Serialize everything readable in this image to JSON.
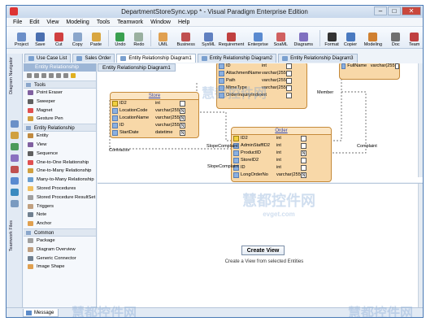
{
  "window": {
    "title": "DepartmentStoreSync.vpp * - Visual Paradigm Enterprise Edition",
    "controls": {
      "minimize": "–",
      "maximize": "□",
      "close": "✕"
    }
  },
  "menu": [
    "File",
    "Edit",
    "View",
    "Modeling",
    "Tools",
    "Teamwork",
    "Window",
    "Help"
  ],
  "toolbar": [
    {
      "label": "Project",
      "icon": "project-icon",
      "color": "#6b8ec8"
    },
    {
      "label": "Save",
      "icon": "save-icon",
      "color": "#4a6fb0"
    },
    {
      "label": "Cut",
      "icon": "cut-icon",
      "color": "#d04040"
    },
    {
      "label": "Copy",
      "icon": "copy-icon",
      "color": "#8aa6cb"
    },
    {
      "label": "Paste",
      "icon": "paste-icon",
      "color": "#d9a640"
    },
    {
      "label": "Undo",
      "icon": "undo-icon",
      "color": "#3aa050"
    },
    {
      "label": "Redo",
      "icon": "redo-icon",
      "color": "#9ab0a0"
    },
    {
      "label": "UML",
      "icon": "uml-icon",
      "color": "#e0a050"
    },
    {
      "label": "Business",
      "icon": "business-icon",
      "color": "#c05050"
    },
    {
      "label": "SysML",
      "icon": "sysml-icon",
      "color": "#6080c0"
    },
    {
      "label": "Requirement",
      "icon": "requirement-icon",
      "color": "#c04040"
    },
    {
      "label": "Enterprise",
      "icon": "enterprise-icon",
      "color": "#5a8ad0"
    },
    {
      "label": "SoaML",
      "icon": "soaml-icon",
      "color": "#d06060"
    },
    {
      "label": "Diagrams",
      "icon": "diagrams-icon",
      "color": "#8070c0"
    },
    {
      "label": "Format",
      "icon": "format-icon",
      "color": "#333333"
    },
    {
      "label": "Copier",
      "icon": "copier-icon",
      "color": "#4a7ac0"
    },
    {
      "label": "Modeling",
      "icon": "modeling-icon",
      "color": "#d08030"
    },
    {
      "label": "Doc",
      "icon": "doc-icon",
      "color": "#707070"
    },
    {
      "label": "Team",
      "icon": "team-icon",
      "color": "#c04040"
    }
  ],
  "tabs": [
    "Use Case List",
    "Sales Order",
    "Entity Relationship Diagram1",
    "Entity Relationship Diagram2",
    "Entity Relationship Diagram3"
  ],
  "active_tab": 2,
  "left_strip": {
    "top_label": "Diagram Navigator",
    "bottom_label": "Teamwork Files"
  },
  "palette": {
    "title": "Entity Relationship Diagram1",
    "sections": {
      "tools": "Tools",
      "tools_items": [
        "Point Eraser",
        "Sweeper",
        "Magnet",
        "Gesture Pen"
      ],
      "er": "Entity Relationship",
      "er_items": [
        "Entity",
        "View",
        "Sequence",
        "One-to-One Relationship",
        "One-to-Many Relationship",
        "Many-to-Many Relationship",
        "Stored Procedures",
        "Stored Procedure ResultSet",
        "Triggers",
        "Note",
        "Anchor"
      ],
      "common": "Common",
      "common_items": [
        "Package",
        "Diagram Overview",
        "Generic Connector",
        "Image Shape"
      ]
    }
  },
  "canvas": {
    "diagram_label": "Entity Relationship Diagram1",
    "entities": {
      "store": {
        "name": "Store",
        "rows": [
          {
            "key": "pk",
            "name": "ID2",
            "type": "int",
            "nn": ""
          },
          {
            "key": "col",
            "name": "LocationCode",
            "type": "varchar(255)",
            "nn": "N"
          },
          {
            "key": "col",
            "name": "LocationName",
            "type": "varchar(255)",
            "nn": "N"
          },
          {
            "key": "col",
            "name": "ID",
            "type": "varchar(255)",
            "nn": "N"
          },
          {
            "key": "col",
            "name": "StartDate",
            "type": "datetime",
            "nn": "N"
          }
        ]
      },
      "attachment": {
        "name": "",
        "rows": [
          {
            "key": "col",
            "name": "ID",
            "type": "int",
            "nn": ""
          },
          {
            "key": "col",
            "name": "AttachmentName",
            "type": "varchar(255)",
            "nn": ""
          },
          {
            "key": "col",
            "name": "Path",
            "type": "varchar(255)",
            "nn": ""
          },
          {
            "key": "col",
            "name": "MimeType",
            "type": "varchar(255)",
            "nn": ""
          },
          {
            "key": "col",
            "name": "OrderInquiryIndex",
            "type": "int",
            "nn": ""
          }
        ]
      },
      "order": {
        "name": "Order",
        "rows": [
          {
            "key": "pk",
            "name": "ID2",
            "type": "int",
            "nn": ""
          },
          {
            "key": "fk",
            "name": "AdminStaffID2",
            "type": "int",
            "nn": ""
          },
          {
            "key": "fk",
            "name": "ProductID",
            "type": "int",
            "nn": "N"
          },
          {
            "key": "fk",
            "name": "StoreID2",
            "type": "int",
            "nn": ""
          },
          {
            "key": "col",
            "name": "ID",
            "type": "int",
            "nn": ""
          },
          {
            "key": "col",
            "name": "LongOrderNo",
            "type": "varchar(255)",
            "nn": "N"
          }
        ]
      },
      "member": {
        "name": "",
        "rows": [
          {
            "key": "col",
            "name": "FullName",
            "type": "varchar(255)",
            "nn": ""
          }
        ]
      }
    },
    "labels": {
      "member": "Member",
      "contractor": "Contractor",
      "slope1": "SlopeComplaint",
      "slope2": "SlopeComplaint",
      "complaint": "Complaint"
    }
  },
  "overview": {
    "button": "Create View",
    "desc": "Create a View from selected Entities"
  },
  "message_tab": "Message",
  "watermark": {
    "top": "慧都控件网",
    "url": "evget.com",
    "bottom1": "慧都控件网",
    "bottom2": "慧都控件网"
  }
}
